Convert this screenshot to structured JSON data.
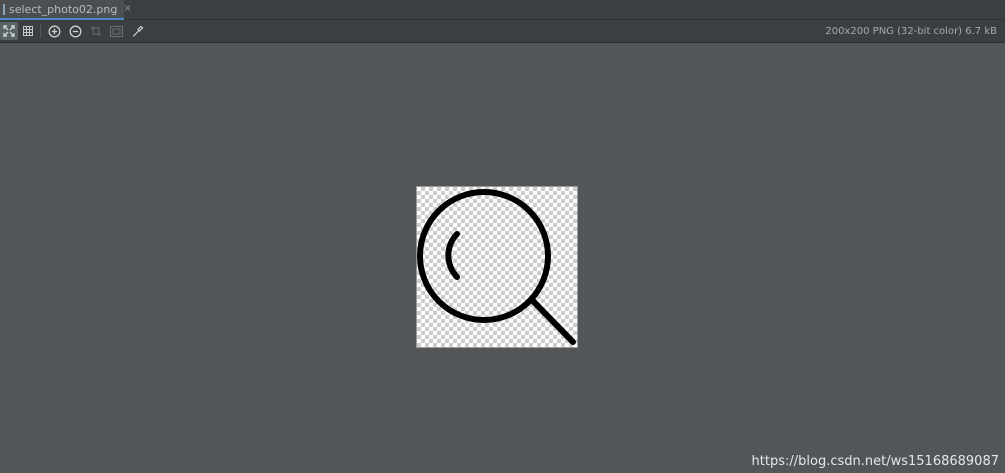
{
  "tab": {
    "filename": "select_photo02.png",
    "close_glyph": "×",
    "icon": "image-file-icon"
  },
  "toolbar": {
    "buttons": [
      {
        "name": "fit-zoom-icon",
        "active": true
      },
      {
        "name": "grid-icon",
        "active": false
      },
      {
        "name": "zoom-in-icon",
        "active": false
      },
      {
        "name": "zoom-out-icon",
        "active": false
      },
      {
        "name": "actual-size-icon",
        "active": false
      },
      {
        "name": "fit-window-icon",
        "active": false
      },
      {
        "name": "color-picker-icon",
        "active": false
      }
    ],
    "image_info": "200x200 PNG (32-bit color) 6.7 kB"
  },
  "image_content": {
    "icon": "magnifier-icon",
    "stroke_color": "#000000",
    "background": "transparent-checkerboard"
  },
  "watermark": "https://blog.csdn.net/ws15168689087",
  "colors": {
    "editor_bg": "#525659",
    "toolbar_bg": "#3c3f41",
    "tab_underline": "#4a88c7"
  }
}
